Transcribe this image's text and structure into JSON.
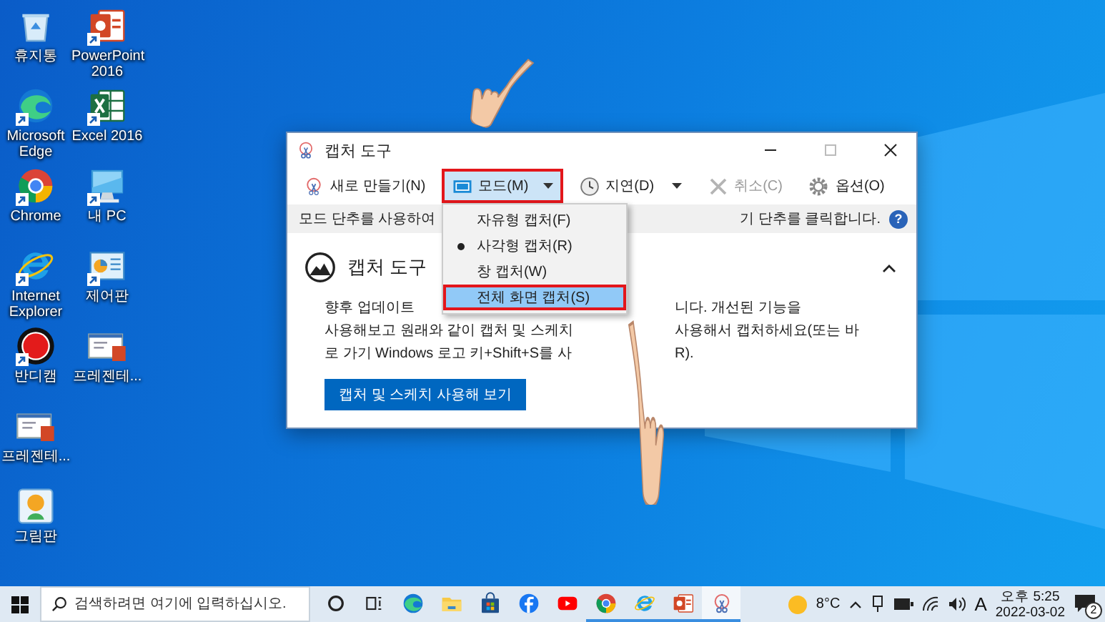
{
  "desktop_icons": [
    {
      "kind": "recycle-bin",
      "label": "휴지통",
      "shortcut": false
    },
    {
      "kind": "powerpoint",
      "label": "PowerPoint 2016",
      "shortcut": true
    },
    {
      "kind": "edge",
      "label": "Microsoft Edge",
      "shortcut": true
    },
    {
      "kind": "excel",
      "label": "Excel 2016",
      "shortcut": true
    },
    {
      "kind": "chrome",
      "label": "Chrome",
      "shortcut": true
    },
    {
      "kind": "pc",
      "label": "내 PC",
      "shortcut": true
    },
    {
      "kind": "ie",
      "label": "Internet Explorer",
      "shortcut": true
    },
    {
      "kind": "control-panel",
      "label": "제어판",
      "shortcut": true
    },
    {
      "kind": "record",
      "label": "반디캠",
      "shortcut": true
    },
    {
      "kind": "slide-file",
      "label": "프레젠테...",
      "shortcut": false
    },
    {
      "kind": "slide-file",
      "label": "프레젠테...",
      "shortcut": false
    },
    {
      "kind": "paint",
      "label": "그림판",
      "shortcut": false
    }
  ],
  "window": {
    "title": "캡처 도구",
    "controls": [
      {
        "kind": "minimize",
        "disabled": false
      },
      {
        "kind": "maximize",
        "disabled": true
      },
      {
        "kind": "close",
        "disabled": false
      }
    ],
    "toolbar": [
      {
        "kind": "new",
        "label": "새로 만들기(N)",
        "dropdown": false,
        "disabled": false,
        "pressed": false,
        "annotated": false
      },
      {
        "kind": "mode",
        "label": "모드(M)",
        "dropdown": true,
        "disabled": false,
        "pressed": true,
        "annotated": true
      },
      {
        "kind": "delay",
        "label": "지연(D)",
        "dropdown": true,
        "disabled": false,
        "pressed": false,
        "annotated": false
      },
      {
        "kind": "cancel",
        "label": "취소(C)",
        "dropdown": false,
        "disabled": true,
        "pressed": false,
        "annotated": false
      },
      {
        "kind": "options",
        "label": "옵션(O)",
        "dropdown": false,
        "disabled": false,
        "pressed": false,
        "annotated": false
      }
    ],
    "mode_menu": [
      {
        "label": "자유형 캡처(F)",
        "selected": false,
        "highlighted": false,
        "annotated": false
      },
      {
        "label": "사각형 캡처(R)",
        "selected": true,
        "highlighted": false,
        "annotated": false
      },
      {
        "label": "창 캡처(W)",
        "selected": false,
        "highlighted": false,
        "annotated": false
      },
      {
        "label": "전체 화면 캡처(S)",
        "selected": false,
        "highlighted": true,
        "annotated": true
      }
    ],
    "info_bar": {
      "texts": [
        "모드 단추를 사용하여",
        "기 단추를 클릭합니다."
      ],
      "help": "?"
    },
    "notice": {
      "title": "캡처 도구",
      "expanded": true,
      "lines": [
        [
          "향후 업데이트",
          "니다. 개선된 기능을"
        ],
        [
          "사용해보고 원래와 같이 캡처 및 스케치",
          "사용해서 캡처하세요(또는 바"
        ],
        [
          "로 가기 Windows 로고 키+Shift+S를 사",
          "R)."
        ]
      ],
      "button": "캡처 및 스케치 사용해 보기"
    }
  },
  "taskbar": {
    "search": {
      "placeholder": "검색하려면 여기에 입력하십시오."
    },
    "apps": [
      {
        "kind": "cortana",
        "running": false,
        "active": false
      },
      {
        "kind": "task-view",
        "running": false,
        "active": false
      },
      {
        "kind": "edge",
        "running": false,
        "active": false
      },
      {
        "kind": "folder",
        "running": false,
        "active": false
      },
      {
        "kind": "store",
        "running": false,
        "active": false
      },
      {
        "kind": "facebook",
        "running": false,
        "active": false
      },
      {
        "kind": "youtube",
        "running": false,
        "active": false
      },
      {
        "kind": "chrome",
        "running": true,
        "active": false
      },
      {
        "kind": "ie",
        "running": true,
        "active": false
      },
      {
        "kind": "powerpoint",
        "running": true,
        "active": false
      },
      {
        "kind": "snipping",
        "running": true,
        "active": true
      }
    ],
    "weather": "8°C",
    "ime": "A",
    "time": "오후 5:25",
    "date": "2022-03-02",
    "notifications": "2"
  }
}
